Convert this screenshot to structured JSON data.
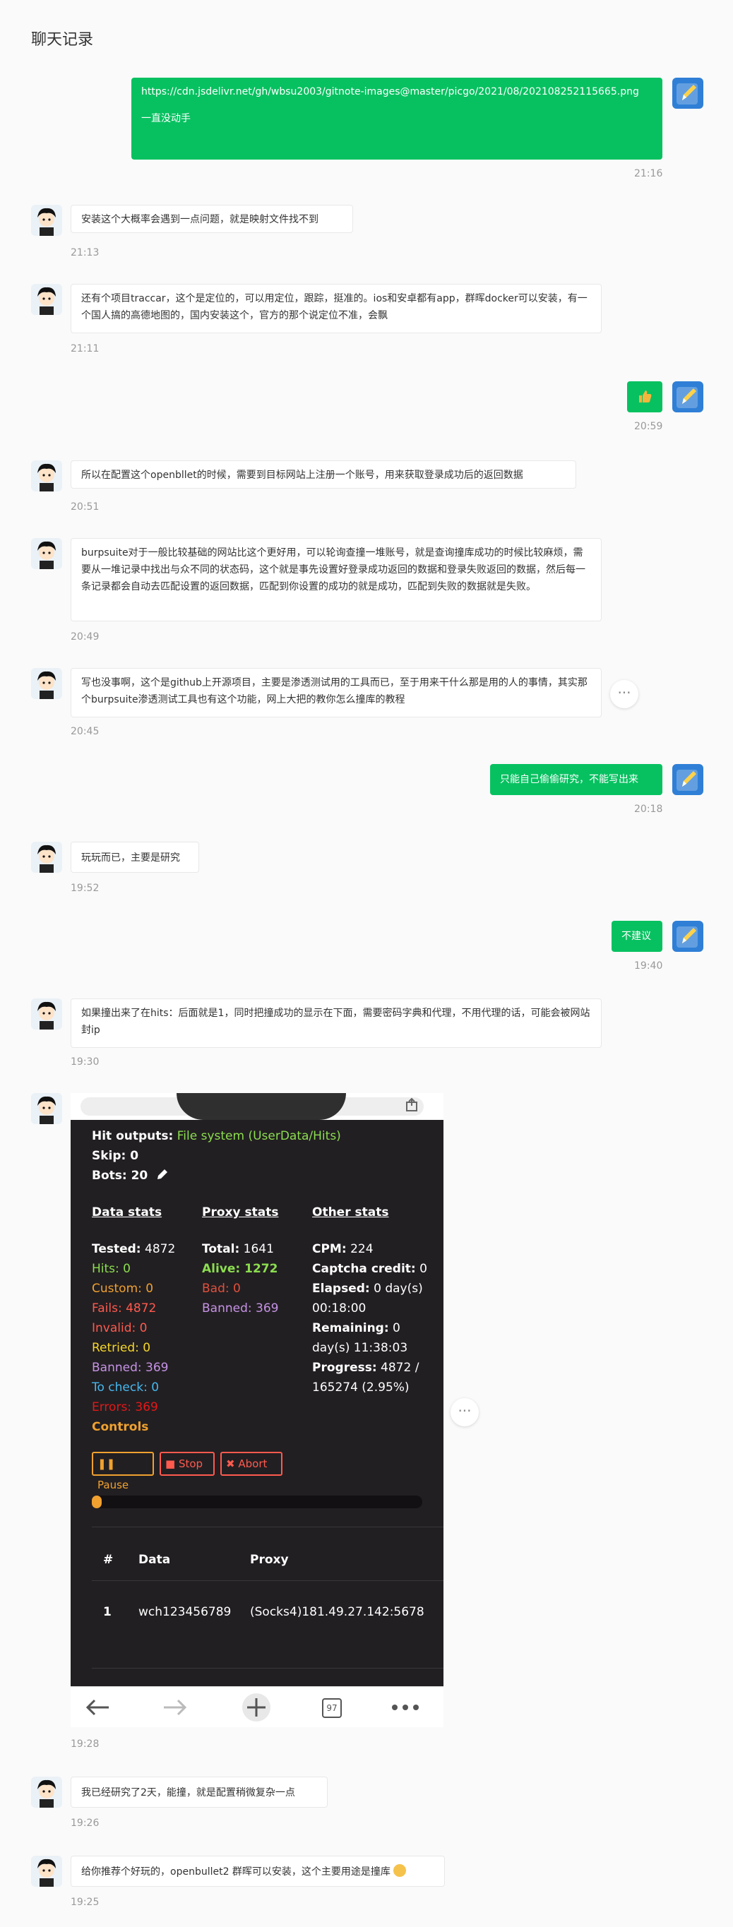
{
  "header": {
    "title": "聊天记录"
  },
  "messages": [
    {
      "text": "https://cdn.jsdelivr.net/gh/wbsu2003/gitnote-images@master/picgo/2021/08/202108252115665.png",
      "text2": "一直没动手",
      "time": "21:16"
    },
    {
      "text": "安装这个大概率会遇到一点问题，就是映射文件找不到",
      "time": "21:13"
    },
    {
      "text": "还有个项目traccar，这个是定位的，可以用定位，跟踪，挺准的。ios和安卓都有app，群晖docker可以安装，有一个国人搞的高德地图的，国内安装这个，官方的那个说定位不准，会飘",
      "time": "21:11"
    },
    {
      "text": "👍",
      "time": "20:59"
    },
    {
      "text": "所以在配置这个openbllet的时候，需要到目标网站上注册一个账号，用来获取登录成功后的返回数据",
      "time": "20:51"
    },
    {
      "text": "burpsuite对于一般比较基础的网站比这个更好用，可以轮询查撞一堆账号，就是查询撞库成功的时候比较麻烦，需要从一堆记录中找出与众不同的状态码，这个就是事先设置好登录成功返回的数据和登录失败返回的数据，然后每一条记录都会自动去匹配设置的返回数据，匹配到你设置的成功的就是成功，匹配到失败的数据就是失败。",
      "time": "20:49"
    },
    {
      "text": "写也没事啊，这个是github上开源项目，主要是渗透测试用的工具而已，至于用来干什么那是用的人的事情，其实那个burpsuite渗透测试工具也有这个功能，网上大把的教你怎么撞库的教程",
      "time": "20:45"
    },
    {
      "text": "只能自己偷偷研究，不能写出来",
      "time": "20:18"
    },
    {
      "text": "玩玩而已，主要是研究",
      "time": "19:52"
    },
    {
      "text": "不建议",
      "time": "19:40"
    },
    {
      "text": "如果撞出来了在hits：后面就是1，同时把撞成功的显示在下面，需要密码字典和代理，不用代理的话，可能会被网站封ip",
      "time": "19:30"
    },
    {
      "time": "19:28"
    },
    {
      "text": "我已经研究了2天，能撞，就是配置稍微复杂一点",
      "time": "19:26"
    },
    {
      "text": "给你推荐个好玩的，openbullet2 群晖可以安装，这个主要用途是撞库",
      "time": "19:25"
    }
  ],
  "more_glyph": "···",
  "screenshot": {
    "hit_outputs_label": "Hit outputs:",
    "hit_outputs_value": "File system (UserData/Hits)",
    "skip": "Skip: 0",
    "bots": "Bots: 20",
    "data_stats_title": "Data stats",
    "proxy_stats_title": "Proxy stats",
    "other_stats_title": "Other stats",
    "tested_label": "Tested:",
    "tested_value": "4872",
    "hits": "Hits: 0",
    "custom": "Custom: 0",
    "fails": "Fails: 4872",
    "invalid": "Invalid: 0",
    "retried": "Retried: 0",
    "banned": "Banned: 369",
    "to_check": "To check: 0",
    "errors": "Errors: 369",
    "controls": "Controls",
    "total_label": "Total:",
    "total_value": "1641",
    "alive": "Alive: 1272",
    "bad": "Bad: 0",
    "proxy_banned": "Banned: 369",
    "cpm_label": "CPM:",
    "cpm_value": "224",
    "captcha_label": "Captcha credit:",
    "captcha_value": "0",
    "elapsed_label": "Elapsed:",
    "elapsed_value": "0 day(s)",
    "elapsed_value2": "00:18:00",
    "remaining_label": "Remaining:",
    "remaining_value": "0",
    "remaining_value2": "day(s) 11:38:03",
    "progress_label": "Progress:",
    "progress_value": "4872 /",
    "progress_value2": "165274 (2.95%)",
    "progress_fraction": 0.0295,
    "btn_pause": "Pause",
    "btn_stop": "Stop",
    "btn_abort": "Abort",
    "table_headers": [
      "#",
      "Data",
      "Proxy"
    ],
    "row1": [
      "1",
      "wch123456789",
      "(Socks4)181.49.27.142:5678"
    ],
    "tab_count": "97"
  },
  "colors": {
    "bubble_green": "#07c160",
    "dark_bg": "#221f22"
  }
}
